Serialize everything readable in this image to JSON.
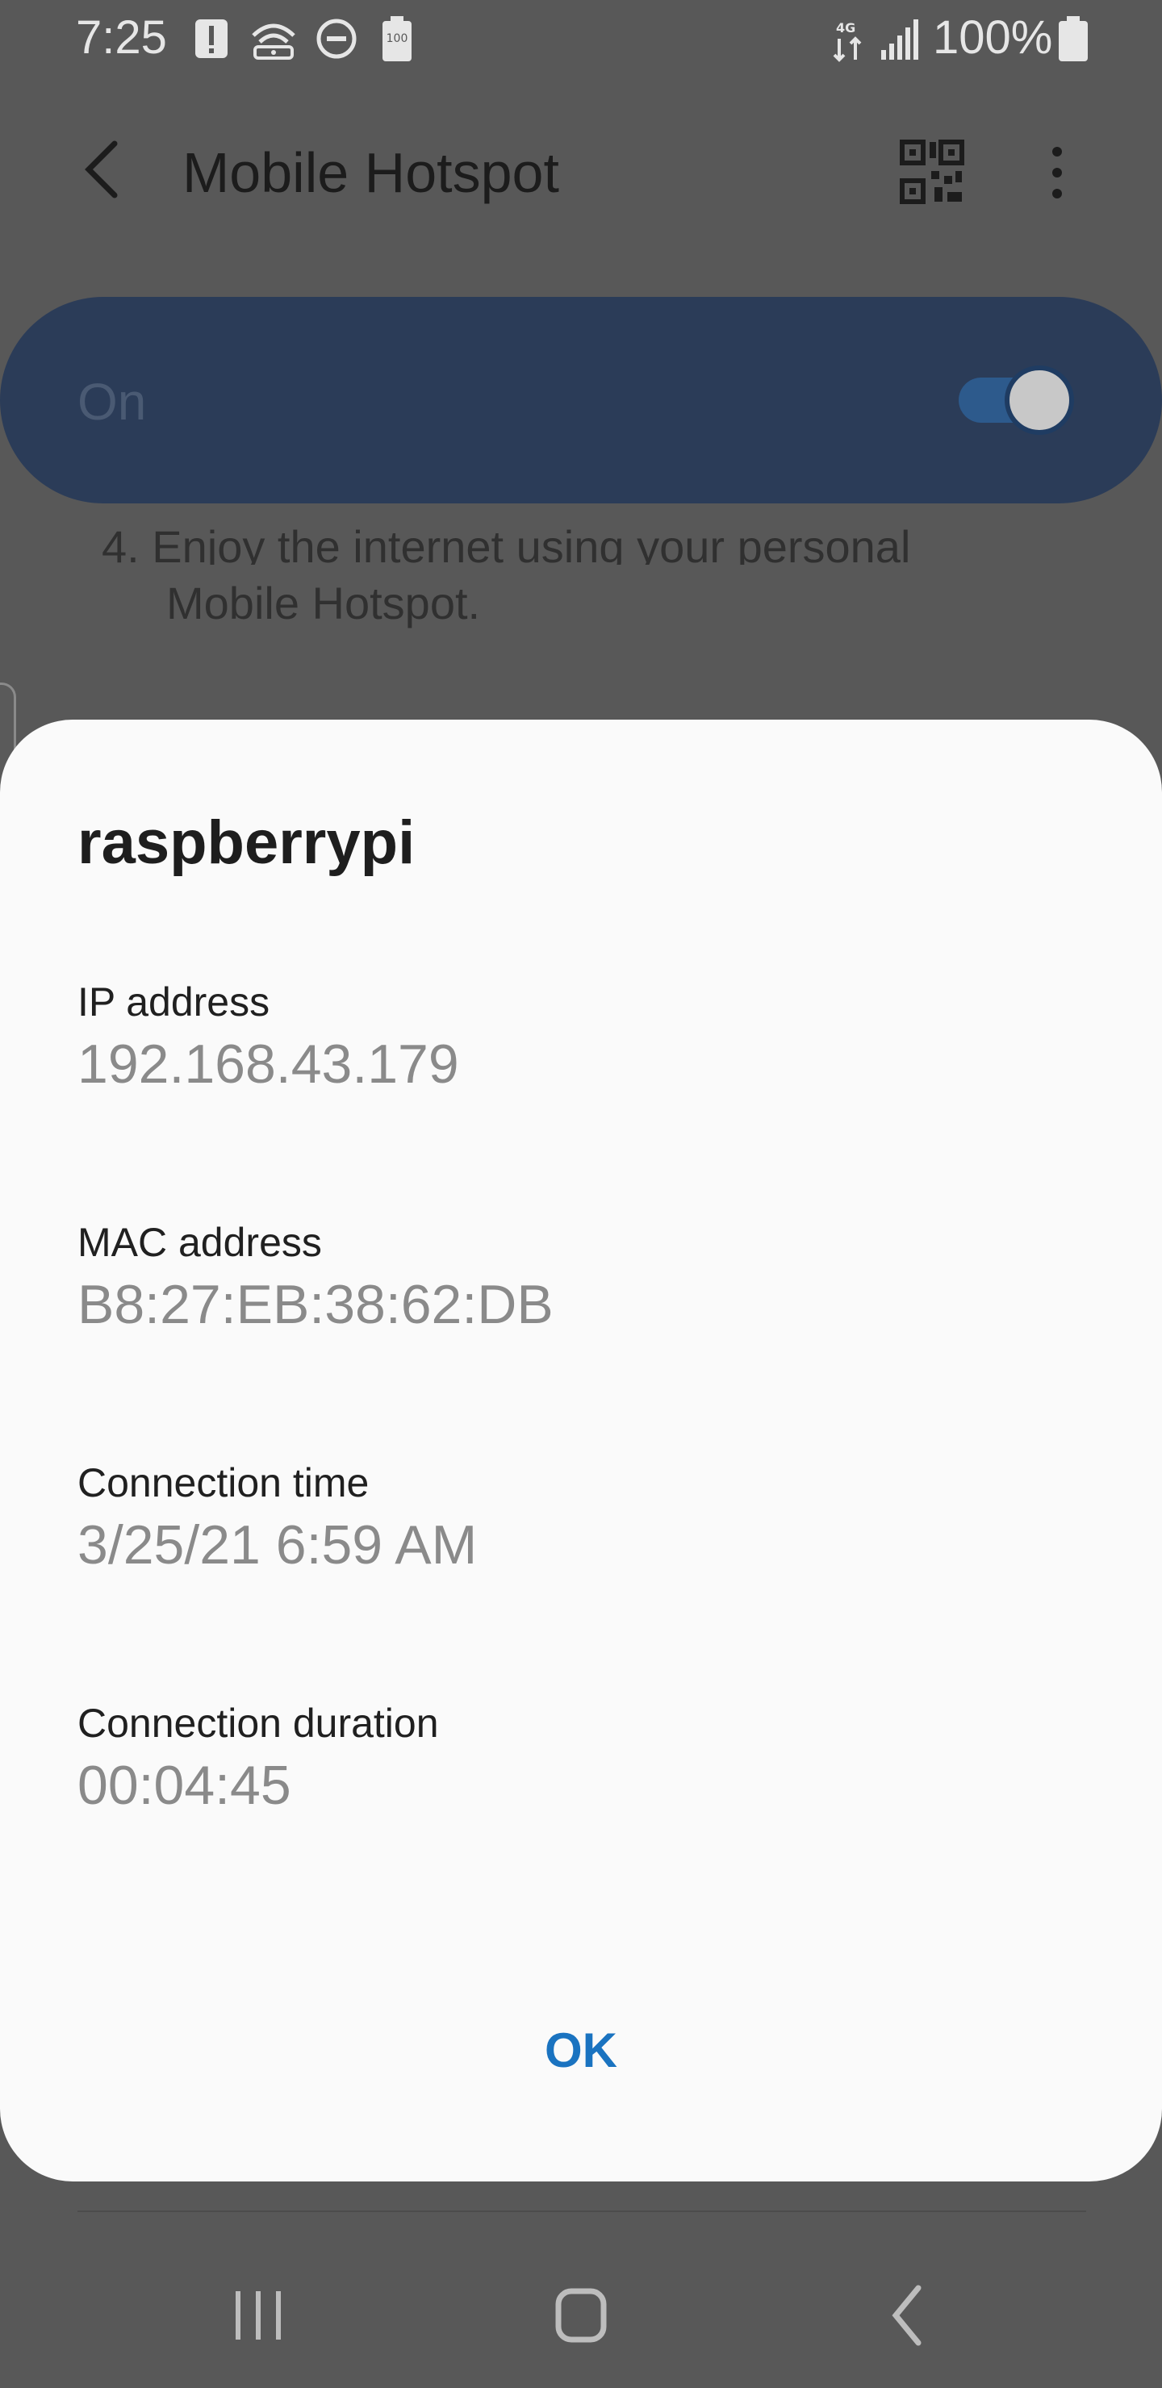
{
  "status_bar": {
    "time": "7:25",
    "battery_percent": "100%",
    "battery_icon_label": "100"
  },
  "app_bar": {
    "title": "Mobile Hotspot"
  },
  "master_switch": {
    "label": "On",
    "state": "on"
  },
  "background_content": {
    "step_text": "4.  Enjoy the internet using your personal",
    "step_text_cont": "Mobile Hotspot."
  },
  "dialog": {
    "title": "raspberrypi",
    "fields": [
      {
        "label": "IP address",
        "value": "192.168.43.179"
      },
      {
        "label": "MAC address",
        "value": "B8:27:EB:38:62:DB"
      },
      {
        "label": "Connection time",
        "value": "3/25/21 6:59 AM"
      },
      {
        "label": "Connection duration",
        "value": "00:04:45"
      }
    ],
    "ok_label": "OK"
  },
  "colors": {
    "accent": "#1a73c0",
    "master_bar": "#2b3c58",
    "scrim": "#585858"
  }
}
